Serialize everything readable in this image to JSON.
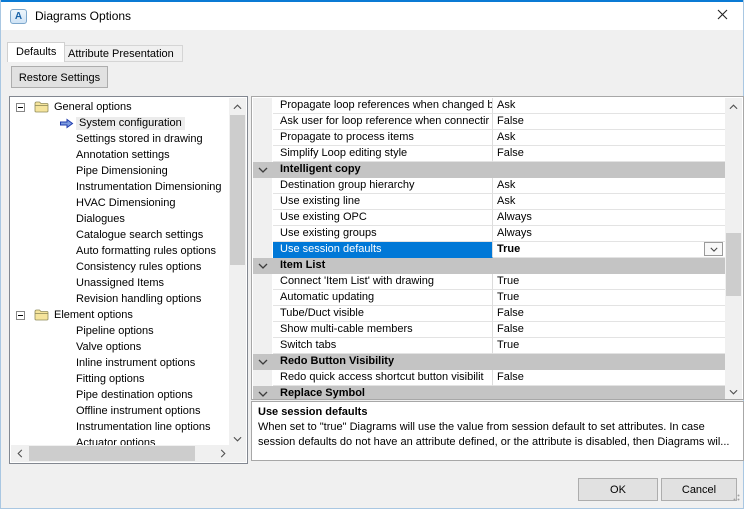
{
  "window": {
    "title": "Diagrams Options",
    "app_icon_letter": "A"
  },
  "tabs": [
    {
      "label": "Defaults",
      "active": true
    },
    {
      "label": "Attribute Presentation",
      "active": false
    }
  ],
  "toolbar": {
    "restore_button": "Restore Settings"
  },
  "tree": {
    "items": [
      {
        "label": "General options",
        "type": "root",
        "expanded": true
      },
      {
        "label": "System configuration",
        "type": "child",
        "selected": true
      },
      {
        "label": "Settings stored in drawing",
        "type": "child"
      },
      {
        "label": "Annotation settings",
        "type": "child"
      },
      {
        "label": "Pipe Dimensioning",
        "type": "child"
      },
      {
        "label": "Instrumentation Dimensioning",
        "type": "child"
      },
      {
        "label": "HVAC Dimensioning",
        "type": "child"
      },
      {
        "label": "Dialogues",
        "type": "child"
      },
      {
        "label": "Catalogue search settings",
        "type": "child"
      },
      {
        "label": "Auto formatting rules options",
        "type": "child"
      },
      {
        "label": "Consistency rules options",
        "type": "child"
      },
      {
        "label": "Unassigned Items",
        "type": "child"
      },
      {
        "label": "Revision handling options",
        "type": "child"
      },
      {
        "label": "Element options",
        "type": "root",
        "expanded": true
      },
      {
        "label": "Pipeline options",
        "type": "child"
      },
      {
        "label": "Valve options",
        "type": "child"
      },
      {
        "label": "Inline instrument options",
        "type": "child"
      },
      {
        "label": "Fitting options",
        "type": "child"
      },
      {
        "label": "Pipe destination options",
        "type": "child"
      },
      {
        "label": "Offline instrument options",
        "type": "child"
      },
      {
        "label": "Instrumentation line options",
        "type": "child"
      },
      {
        "label": "Actuator options",
        "type": "child"
      }
    ]
  },
  "grid": {
    "rows": [
      {
        "type": "property",
        "name": "Propagate loop references when changed b",
        "value": "Ask"
      },
      {
        "type": "property",
        "name": "Ask user for loop reference when connectir",
        "value": "False"
      },
      {
        "type": "property",
        "name": "Propagate to process items",
        "value": "Ask"
      },
      {
        "type": "property",
        "name": "Simplify Loop editing style",
        "value": "False"
      },
      {
        "type": "section",
        "name": "Intelligent copy"
      },
      {
        "type": "property",
        "name": "Destination group hierarchy",
        "value": "Ask"
      },
      {
        "type": "property",
        "name": "Use existing line",
        "value": "Ask"
      },
      {
        "type": "property",
        "name": "Use existing OPC",
        "value": "Always"
      },
      {
        "type": "property",
        "name": "Use existing groups",
        "value": "Always"
      },
      {
        "type": "property",
        "name": "Use session defaults",
        "value": "True",
        "selected": true,
        "editor": "combobox"
      },
      {
        "type": "section",
        "name": "Item List"
      },
      {
        "type": "property",
        "name": "Connect 'Item List' with drawing",
        "value": "True"
      },
      {
        "type": "property",
        "name": "Automatic updating",
        "value": "True"
      },
      {
        "type": "property",
        "name": "Tube/Duct visible",
        "value": "False"
      },
      {
        "type": "property",
        "name": "Show multi-cable members",
        "value": "False"
      },
      {
        "type": "property",
        "name": "Switch tabs",
        "value": "True"
      },
      {
        "type": "section",
        "name": "Redo Button Visibility"
      },
      {
        "type": "property",
        "name": "Redo quick access shortcut button visibilit",
        "value": "False"
      },
      {
        "type": "section",
        "name": "Replace Symbol"
      }
    ]
  },
  "description": {
    "title": "Use session defaults",
    "lines": [
      "When set to \"true\" Diagrams will use the value from session default to set attributes. In case",
      "session defaults do not have an attribute defined, or the attribute is disabled, then Diagrams wil..."
    ]
  },
  "footer": {
    "ok_label": "OK",
    "cancel_label": "Cancel"
  },
  "icons": {
    "app": "aveva-a-logo",
    "close": "x-cross",
    "tree_expander": "minus-box",
    "tree_folder": "yellow-folder",
    "tree_selected": "blue-right-arrow",
    "section_chevron": "chevron-down",
    "combobox": "chevron-down",
    "scrollbar": "chevron-arrows"
  },
  "colors": {
    "accent_blue": "#0078d7",
    "selection_blue": "#0078d7",
    "section_gray": "#c4c4c4",
    "dialog_bg": "#f0f0f0",
    "titlebar_bg": "#ffffff",
    "border_gray": "#828790"
  }
}
